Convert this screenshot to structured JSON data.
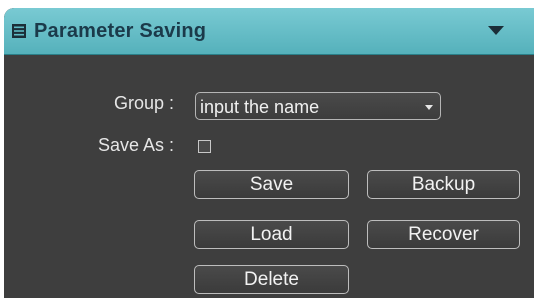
{
  "panel": {
    "title": "Parameter Saving",
    "header_icon": "list-icon",
    "collapse_icon": "chevron-down-icon",
    "header_color": "#5fbbc4",
    "body_color": "#3e3e3e"
  },
  "form": {
    "group_label": "Group :",
    "group_value": "input the name",
    "save_as_label": "Save As :",
    "save_as_checked": false
  },
  "buttons": {
    "save": "Save",
    "backup": "Backup",
    "load": "Load",
    "recover": "Recover",
    "delete": "Delete"
  }
}
